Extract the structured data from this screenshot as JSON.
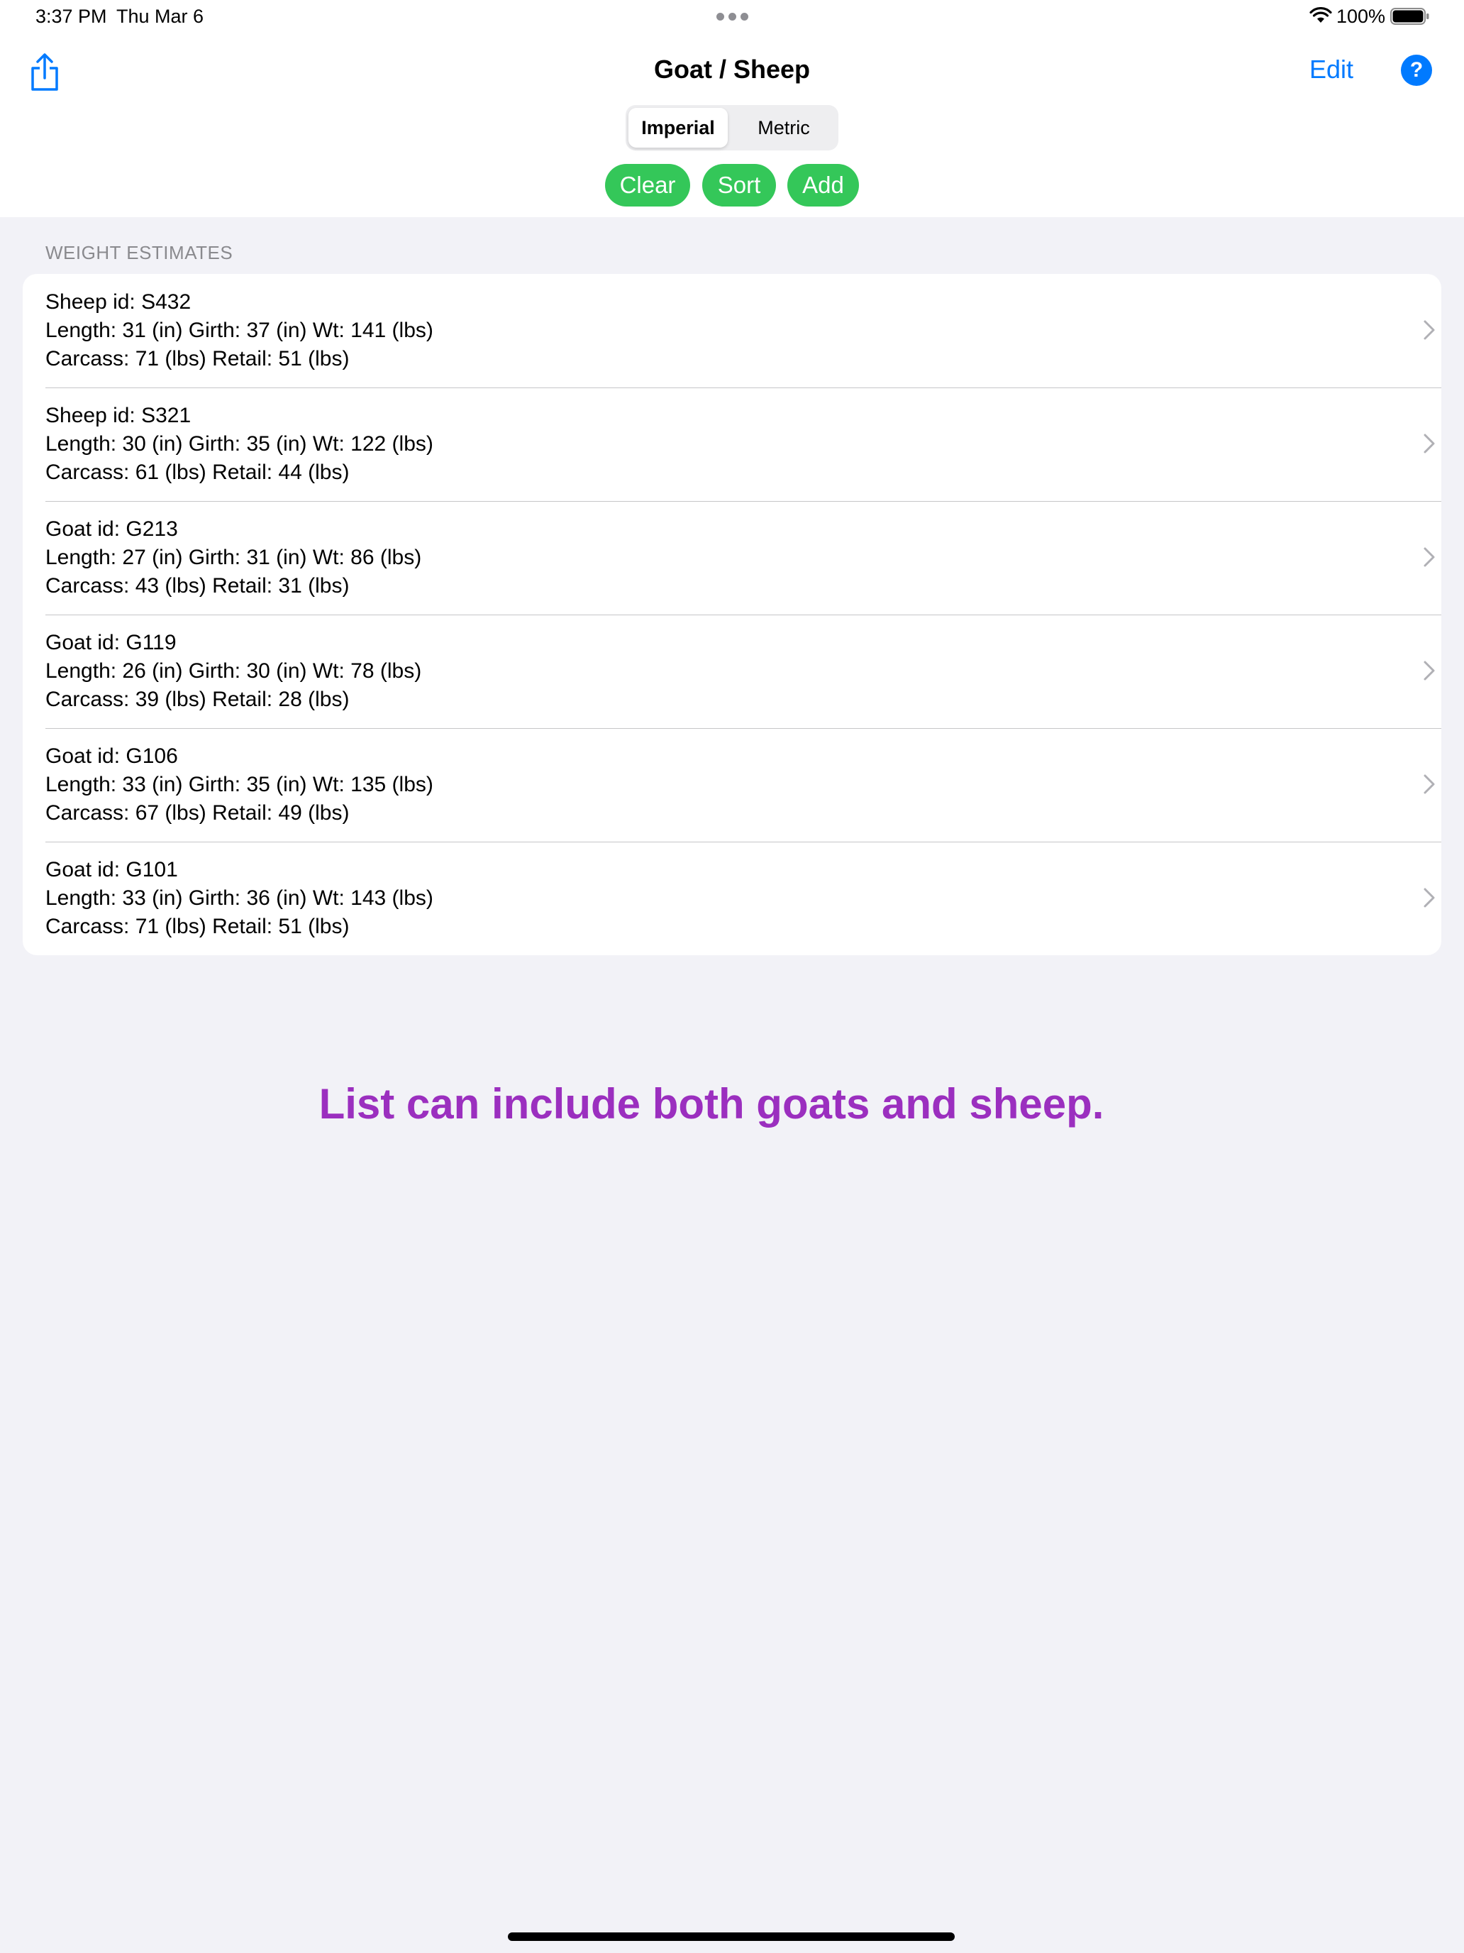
{
  "status_bar": {
    "time": "3:37 PM",
    "date": "Thu Mar 6",
    "battery": "100%",
    "icons": [
      "wifi-icon",
      "battery-icon"
    ]
  },
  "nav": {
    "title": "Goat / Sheep",
    "edit_label": "Edit",
    "help_label": "?",
    "share_icon": "share-icon"
  },
  "units": {
    "options": [
      "Imperial",
      "Metric"
    ],
    "selected": "Imperial"
  },
  "actions": {
    "clear": "Clear",
    "sort": "Sort",
    "add": "Add"
  },
  "section_title": "WEIGHT ESTIMATES",
  "items": [
    {
      "line1": "Sheep id: S432",
      "line2": "Length: 31 (in) Girth: 37 (in) Wt: 141 (lbs)",
      "line3": "Carcass: 71 (lbs) Retail: 51 (lbs)"
    },
    {
      "line1": "Sheep id: S321",
      "line2": "Length: 30 (in) Girth: 35 (in) Wt: 122 (lbs)",
      "line3": "Carcass: 61 (lbs) Retail: 44 (lbs)"
    },
    {
      "line1": "Goat id: G213",
      "line2": "Length: 27 (in) Girth: 31 (in) Wt: 86 (lbs)",
      "line3": "Carcass: 43 (lbs) Retail: 31 (lbs)"
    },
    {
      "line1": "Goat id: G119",
      "line2": "Length: 26 (in) Girth: 30 (in) Wt: 78 (lbs)",
      "line3": "Carcass: 39 (lbs) Retail: 28 (lbs)"
    },
    {
      "line1": "Goat id: G106",
      "line2": "Length: 33 (in) Girth: 35 (in) Wt: 135 (lbs)",
      "line3": "Carcass: 67 (lbs) Retail: 49 (lbs)"
    },
    {
      "line1": "Goat id: G101",
      "line2": "Length: 33 (in) Girth: 36 (in) Wt: 143 (lbs)",
      "line3": "Carcass: 71 (lbs) Retail: 51 (lbs)"
    }
  ],
  "caption": "List can include both goats and sheep.",
  "colors": {
    "accent": "#007aff",
    "action_green": "#34c759",
    "caption_purple": "#9b2fbf",
    "background": "#f2f2f7"
  }
}
